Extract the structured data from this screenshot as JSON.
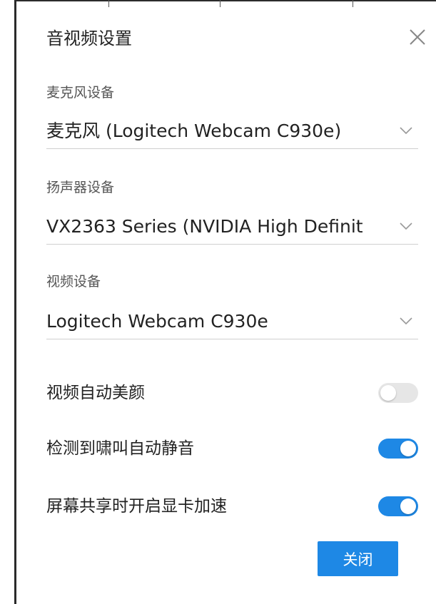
{
  "dialog": {
    "title": "音视频设置",
    "close_icon": "close-icon"
  },
  "microphone": {
    "label": "麦克风设备",
    "value": "麦克风 (Logitech Webcam C930e)"
  },
  "speaker": {
    "label": "扬声器设备",
    "value": "VX2363 Series (NVIDIA High Definit"
  },
  "camera": {
    "label": "视频设备",
    "value": "Logitech Webcam C930e"
  },
  "toggles": [
    {
      "label": "视频自动美颜",
      "enabled": false
    },
    {
      "label": "检测到啸叫自动静音",
      "enabled": true
    },
    {
      "label": "屏幕共享时开启显卡加速",
      "enabled": true
    }
  ],
  "footer": {
    "close_label": "关闭"
  },
  "colors": {
    "accent": "#1e88e5",
    "toggle_off": "#e6e6e6",
    "text": "#222222",
    "muted": "#555555"
  }
}
